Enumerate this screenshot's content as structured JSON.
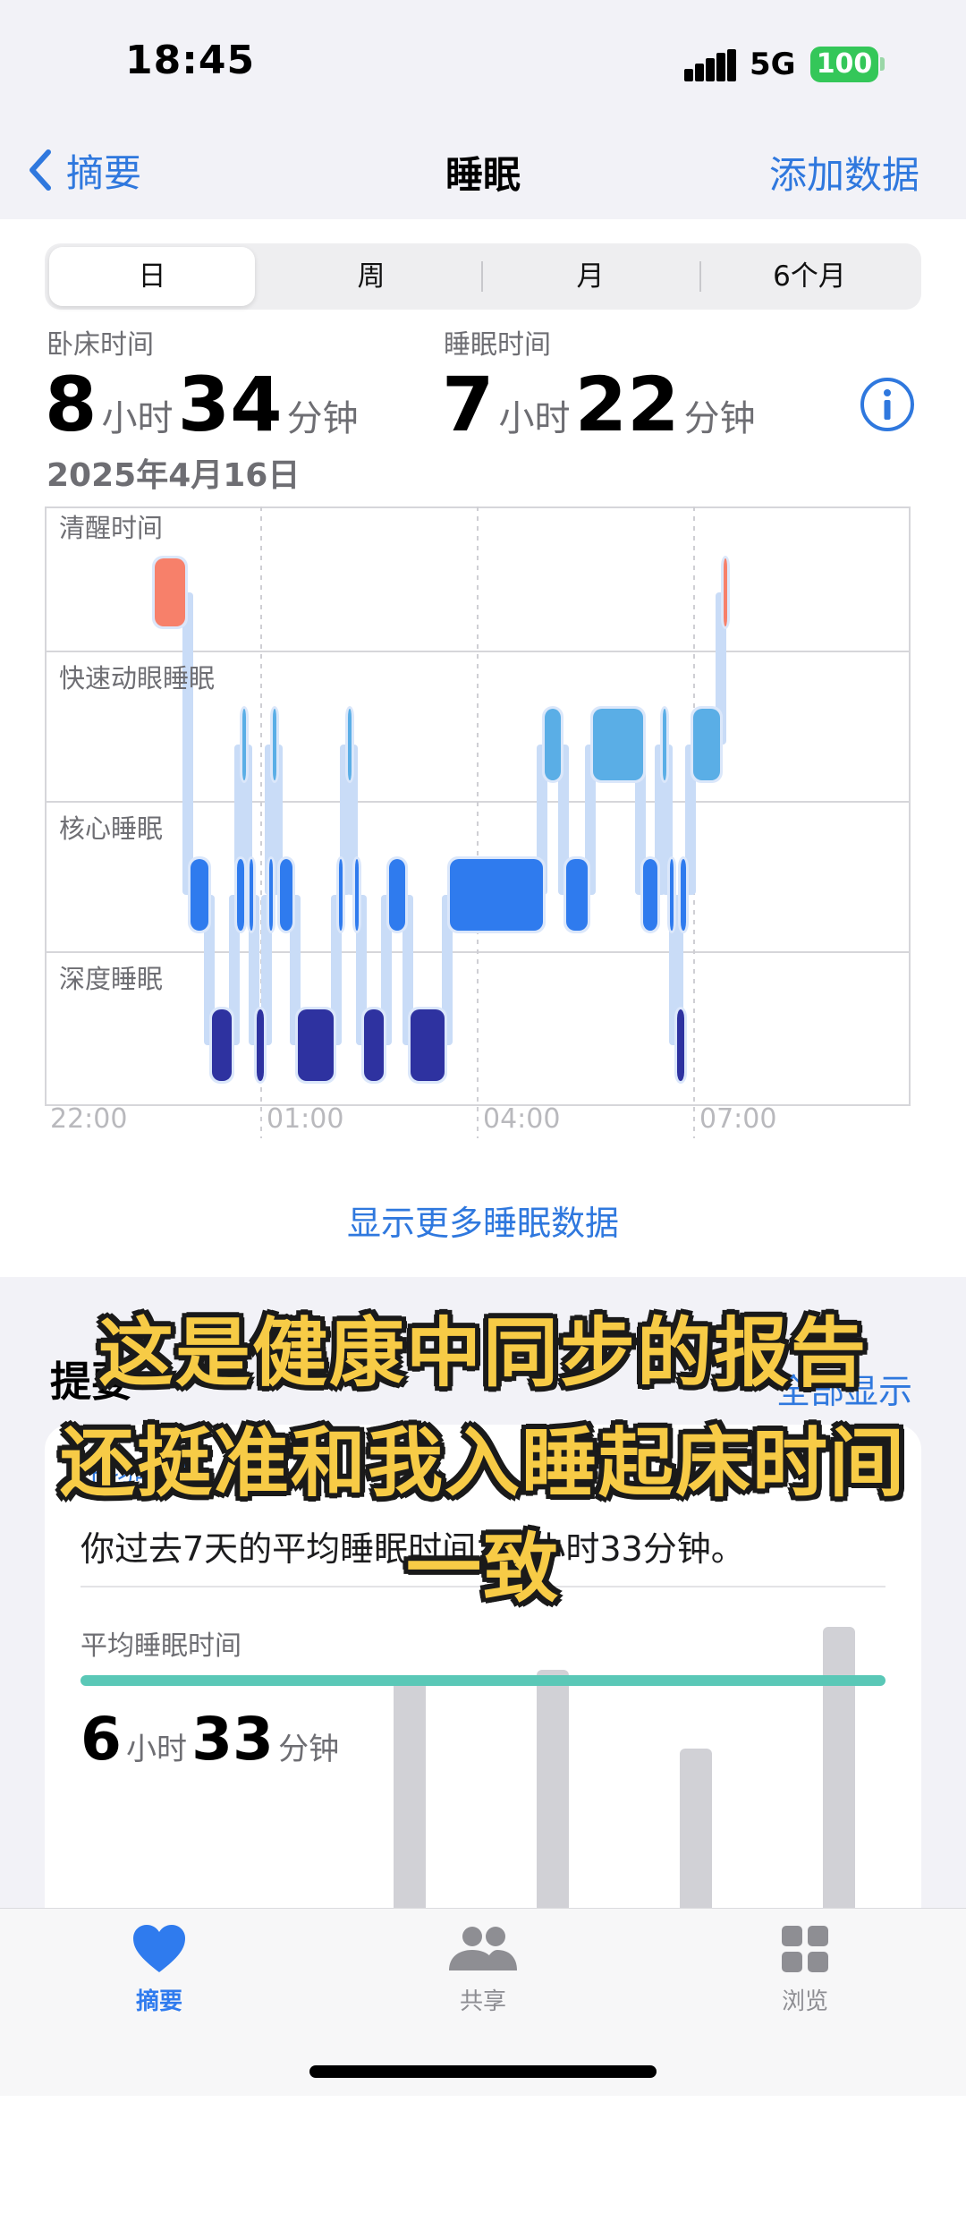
{
  "status": {
    "time": "18:45",
    "network": "5G",
    "battery": "100"
  },
  "nav": {
    "back_label": "摘要",
    "title": "睡眠",
    "action": "添加数据"
  },
  "segments": [
    "日",
    "周",
    "月",
    "6个月"
  ],
  "selected_segment": "日",
  "stats": {
    "in_bed": {
      "label": "卧床时间",
      "hours": "8",
      "hours_unit": "小时",
      "minutes": "34",
      "minutes_unit": "分钟"
    },
    "asleep": {
      "label": "睡眠时间",
      "hours": "7",
      "hours_unit": "小时",
      "minutes": "22",
      "minutes_unit": "分钟"
    },
    "date": "2025年4月16日"
  },
  "chart": {
    "stages": [
      "清醒时间",
      "快速动眼睡眠",
      "核心睡眠",
      "深度睡眠"
    ],
    "ticks": [
      "22:00",
      "01:00",
      "04:00",
      "07:00"
    ],
    "colors": {
      "awake": "#f7806a",
      "rem": "#5aaee6",
      "core": "#2f7bee",
      "deep": "#2e32a0"
    }
  },
  "more_link": "显示更多睡眠数据",
  "highlights": {
    "title": "提要",
    "show_all": "全部显示",
    "card_label": "平均睡眠",
    "summary": "你过去7天的平均睡眠时间为6小时33分钟。",
    "avg_label": "平均睡眠时间",
    "avg_hours": "6",
    "avg_hours_unit": "小时",
    "avg_minutes": "33",
    "avg_minutes_unit": "分钟"
  },
  "captions": [
    "这是健康中同步的报告",
    "还挺准和我入睡起床时间",
    "一致"
  ],
  "tabs": [
    {
      "label": "摘要",
      "icon": "heart-icon",
      "active": true
    },
    {
      "label": "共享",
      "icon": "people-icon",
      "active": false
    },
    {
      "label": "浏览",
      "icon": "grid-icon",
      "active": false
    }
  ]
}
